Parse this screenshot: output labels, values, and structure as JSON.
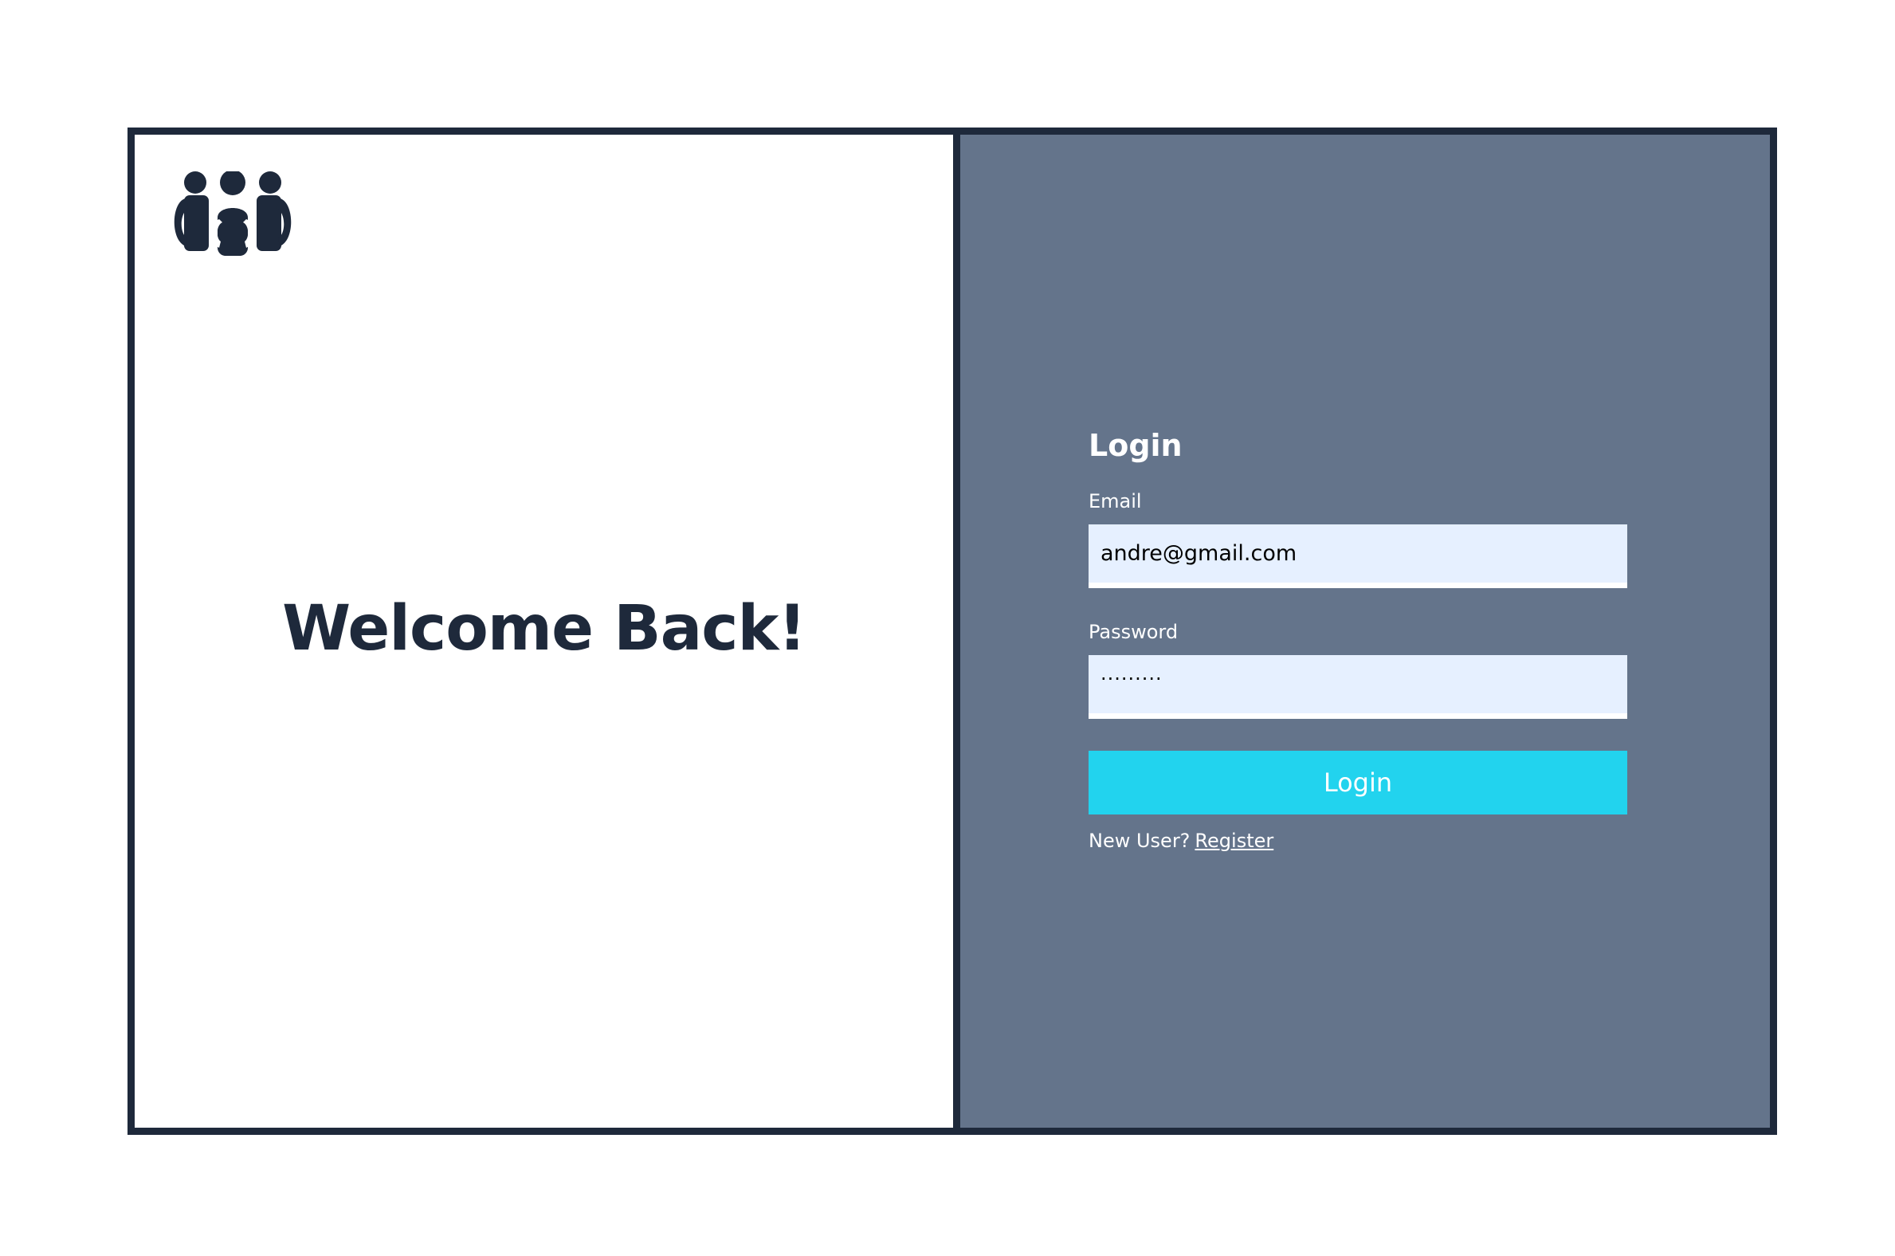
{
  "branding": {
    "logo_icon": "users-group-icon",
    "welcome_text": "Welcome Back!"
  },
  "login_form": {
    "title": "Login",
    "email": {
      "label": "Email",
      "value": "andre@gmail.com"
    },
    "password": {
      "label": "Password",
      "masked_value": "·········"
    },
    "submit_label": "Login",
    "new_user_text": "New User?",
    "register_link_label": "Register"
  },
  "colors": {
    "frame_border": "#1e293b",
    "left_background": "#ffffff",
    "right_background": "#64748b",
    "input_background": "#e6f0ff",
    "button_background": "#22d3ee",
    "heading_text": "#1e293b",
    "form_text": "#ffffff"
  }
}
